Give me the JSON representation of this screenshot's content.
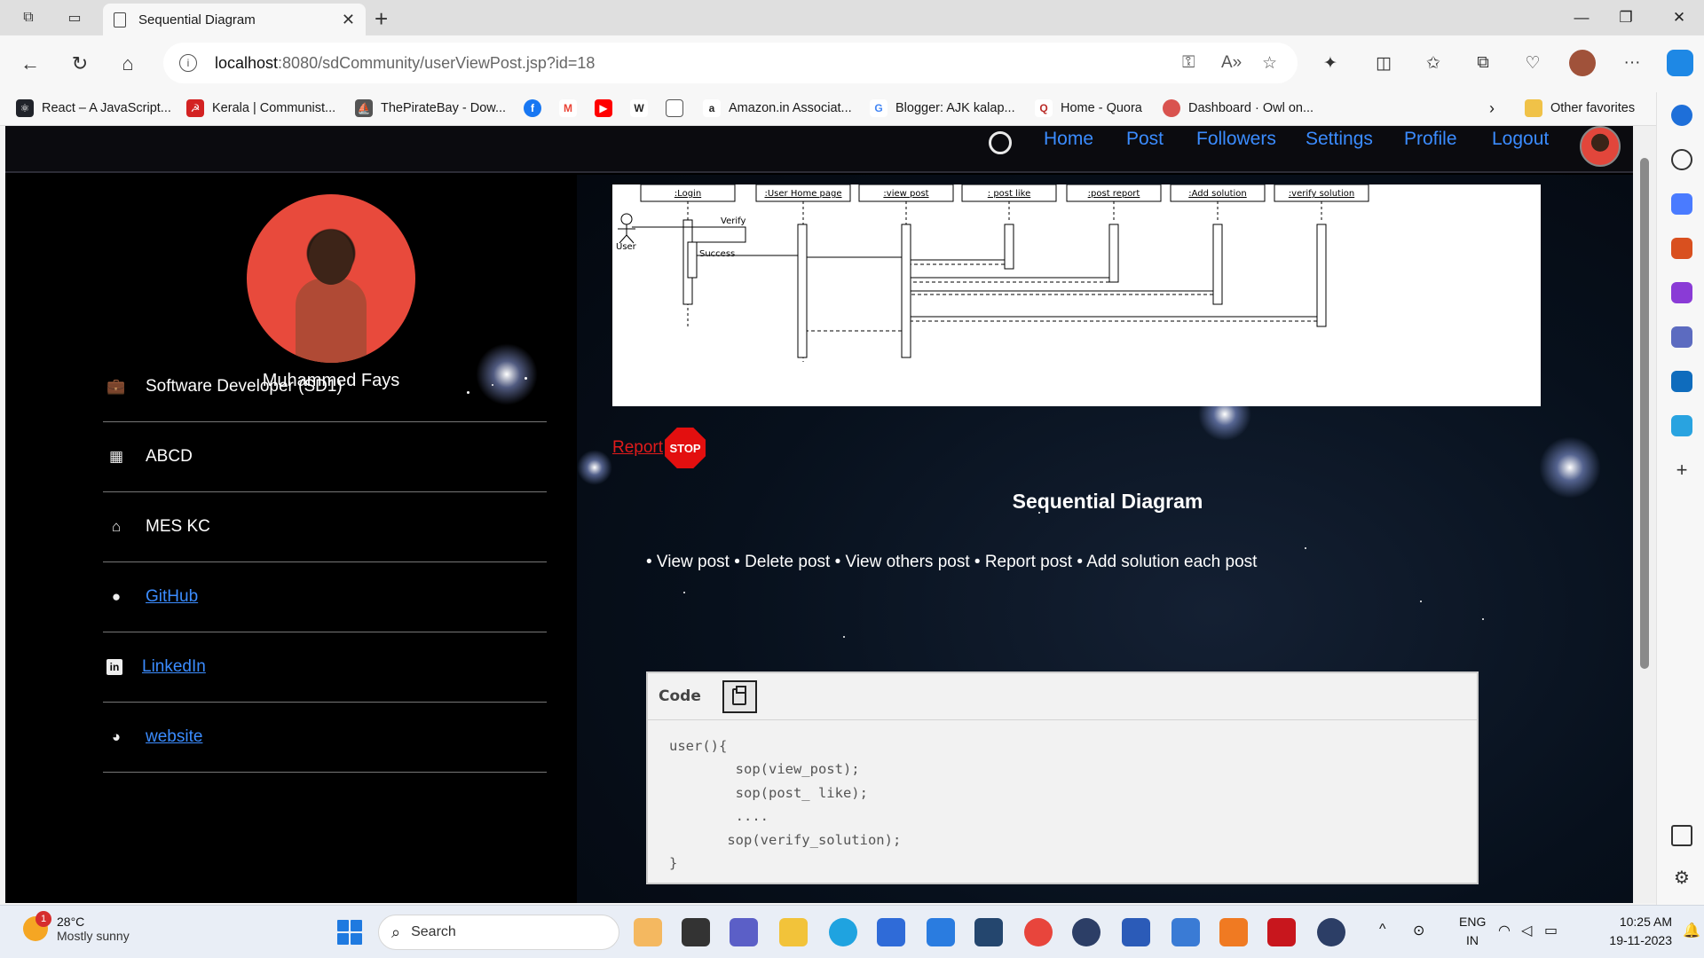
{
  "browser": {
    "tab_title": "Sequential Diagram",
    "url_host": "localhost",
    "url_rest": ":8080/sdCommunity/userViewPost.jsp?id=18",
    "bookmarks": [
      {
        "label": "React – A JavaScript...",
        "color": "#20232a"
      },
      {
        "label": "Kerala | Communist...",
        "color": "#d32222"
      },
      {
        "label": "ThePirateBay - Dow...",
        "color": "#555555"
      },
      {
        "label": "",
        "color": "#1877f2"
      },
      {
        "label": "",
        "color": "#ea4335"
      },
      {
        "label": "",
        "color": "#ff0000"
      },
      {
        "label": "",
        "color": "#333333"
      },
      {
        "label": "",
        "color": "#666666"
      },
      {
        "label": "Amazon.in Associat...",
        "color": "#222222"
      },
      {
        "label": "Blogger: AJK kalap...",
        "color": "#4285f4"
      },
      {
        "label": "Home - Quora",
        "color": "#b92b27"
      },
      {
        "label": "Dashboard · Owl on...",
        "color": "#d9534f"
      }
    ],
    "bookmark_glyphs": [
      "f",
      "M",
      "▶",
      "W",
      ""
    ],
    "other_favorites": "Other favorites"
  },
  "site": {
    "nav": {
      "home": "Home",
      "post": "Post",
      "followers": "Followers",
      "settings": "Settings",
      "profile": "Profile",
      "logout": "Logout"
    },
    "profile": {
      "name": "Muhammed Fays",
      "role": "Software Developer (SD1)",
      "company": "ABCD",
      "college": "MES KC",
      "github": "GitHub",
      "linkedin": "LinkedIn",
      "website": "website"
    },
    "post": {
      "report_label": "Report",
      "stop_text": "STOP",
      "title": "Sequential Diagram",
      "description": "• View post • Delete post • View others post • Report post • Add solution each post",
      "code_label": "Code",
      "code": "user(){\n        sop(view_post);\n        sop(post_ like);\n        ....\n       sop(verify_solution);\n}"
    },
    "diagram": {
      "lifelines": [
        ":Login",
        ":User Home page",
        ":view post",
        ": post like",
        ":post report",
        ":Add solution",
        ":verify solution"
      ],
      "actor": "User",
      "messages": [
        "Verify",
        "Success"
      ]
    }
  },
  "taskbar": {
    "weather_temp": "28°C",
    "weather_desc": "Mostly sunny",
    "weather_badge": "1",
    "search_label": "Search",
    "lang_1": "ENG",
    "lang_2": "IN",
    "time": "10:25 AM",
    "date": "19-11-2023"
  }
}
